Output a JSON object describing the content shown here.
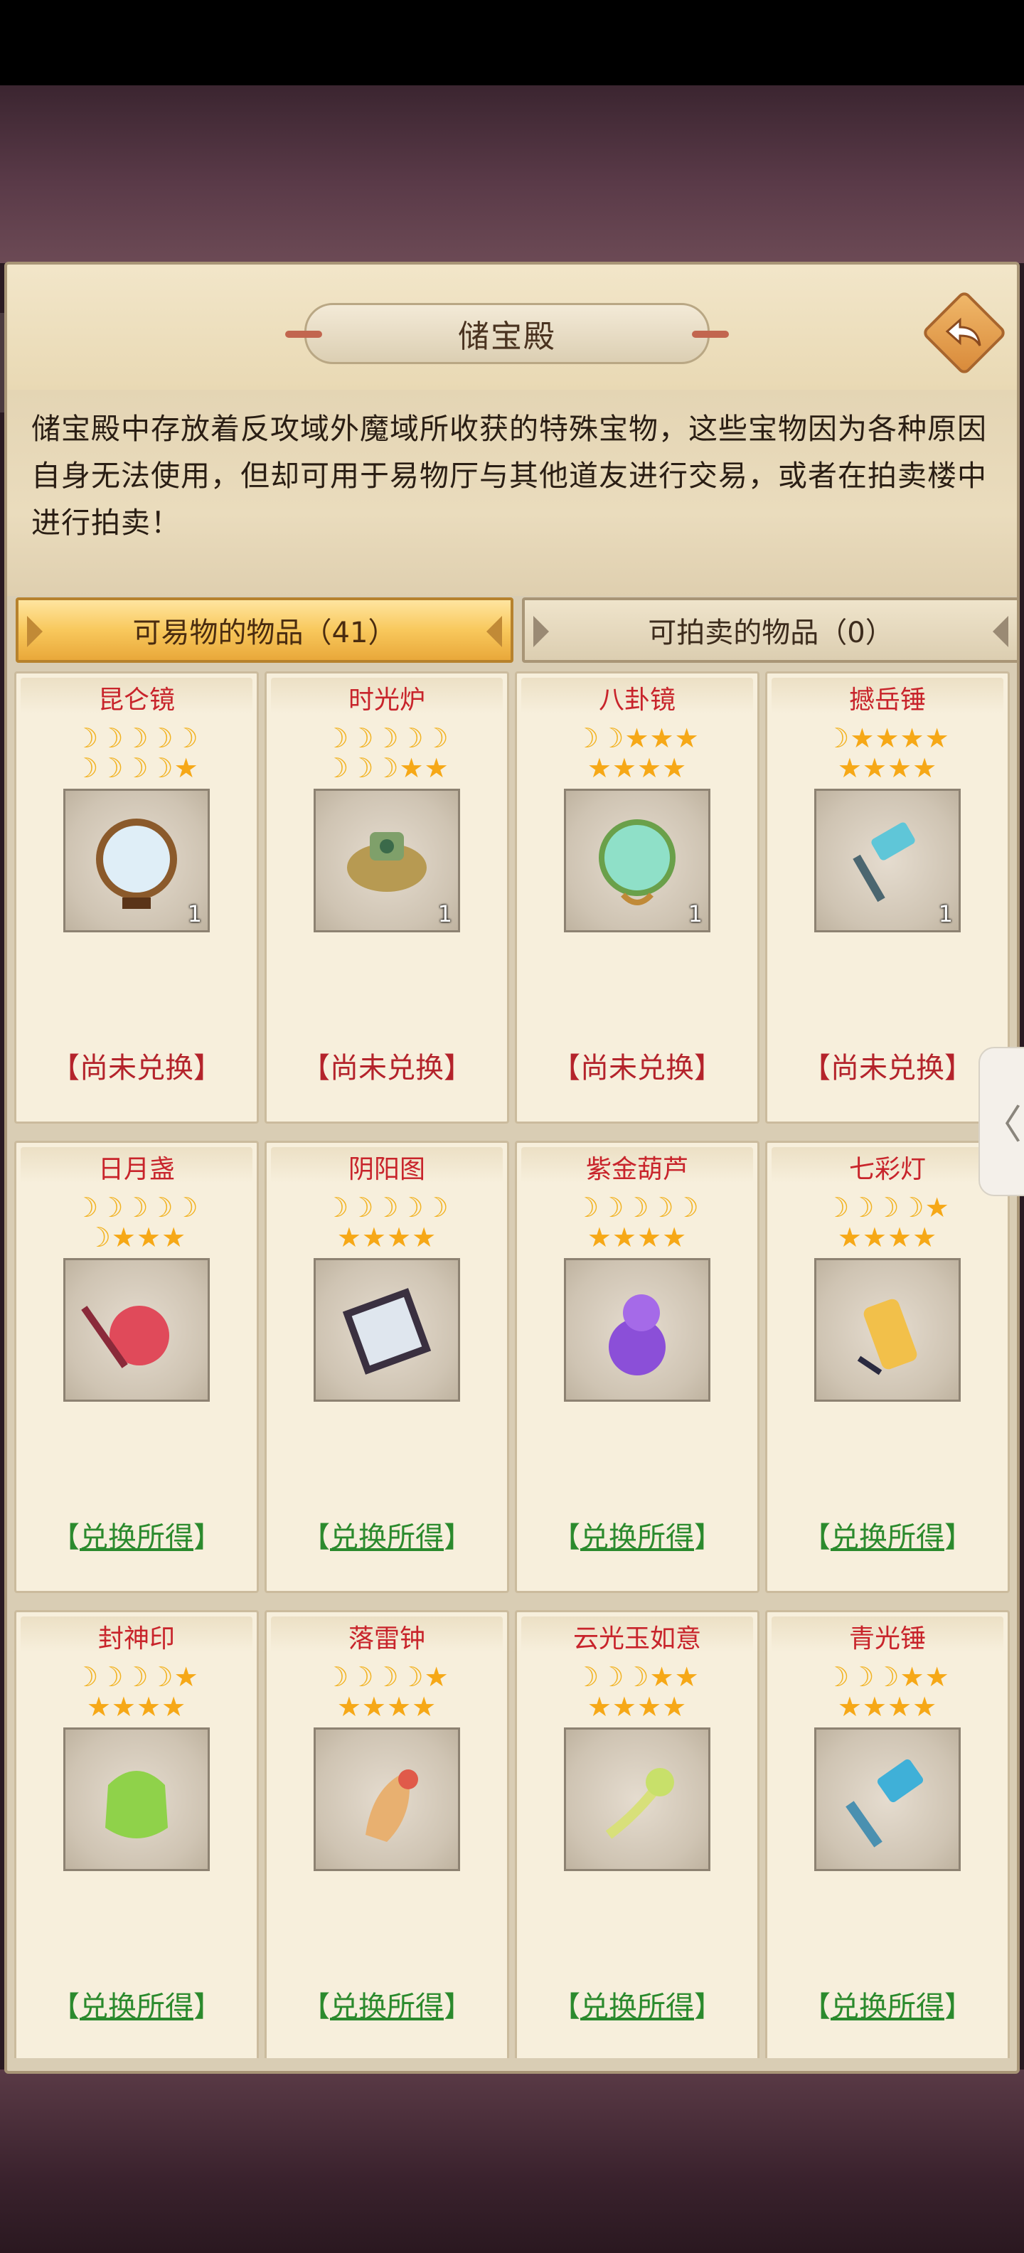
{
  "header": {
    "title": "储宝殿"
  },
  "description": "储宝殿中存放着反攻域外魔域所收获的特殊宝物，这些宝物因为各种原因自身无法使用，但却可用于易物厅与其他道友进行交易，或者在拍卖楼中进行拍卖！",
  "tabs": [
    {
      "label": "可易物的物品（41）",
      "active": true
    },
    {
      "label": "可拍卖的物品（0）",
      "active": false
    }
  ],
  "status_labels": {
    "pending": "【尚未兑换】",
    "done_left": "【",
    "done_text": "兑换所得",
    "done_right": "】"
  },
  "colors": {
    "name_red": "#c8242b",
    "pending_red": "#b4232b",
    "done_green": "#2b8a2d",
    "tab_gold": "#f8c85c"
  },
  "items": [
    {
      "name": "昆仑镜",
      "moons": 9,
      "stars": 1,
      "count": "1",
      "status": "pending",
      "icon": "mirror-icon"
    },
    {
      "name": "时光炉",
      "moons": 8,
      "stars": 2,
      "count": "1",
      "status": "pending",
      "icon": "furnace-icon"
    },
    {
      "name": "八卦镜",
      "moons": 2,
      "stars": 7,
      "count": "1",
      "status": "pending",
      "icon": "bagua-mirror-icon"
    },
    {
      "name": "撼岳锤",
      "moons": 1,
      "stars": 8,
      "count": "1",
      "status": "pending",
      "icon": "hammer-icon"
    },
    {
      "name": "日月盏",
      "moons": 6,
      "stars": 3,
      "count": "",
      "status": "done",
      "icon": "lantern-cup-icon"
    },
    {
      "name": "阴阳图",
      "moons": 5,
      "stars": 4,
      "count": "",
      "status": "done",
      "icon": "scroll-icon"
    },
    {
      "name": "紫金葫芦",
      "moons": 5,
      "stars": 4,
      "count": "",
      "status": "done",
      "icon": "gourd-icon"
    },
    {
      "name": "七彩灯",
      "moons": 4,
      "stars": 5,
      "count": "",
      "status": "done",
      "icon": "lamp-icon"
    },
    {
      "name": "封神印",
      "moons": 4,
      "stars": 5,
      "count": "",
      "status": "done",
      "icon": "seal-icon"
    },
    {
      "name": "落雷钟",
      "moons": 4,
      "stars": 5,
      "count": "",
      "status": "done",
      "icon": "bell-icon"
    },
    {
      "name": "云光玉如意",
      "moons": 3,
      "stars": 6,
      "count": "",
      "status": "done",
      "icon": "ruyi-icon"
    },
    {
      "name": "青光锤",
      "moons": 3,
      "stars": 6,
      "count": "",
      "status": "done",
      "icon": "blue-hammer-icon"
    }
  ]
}
